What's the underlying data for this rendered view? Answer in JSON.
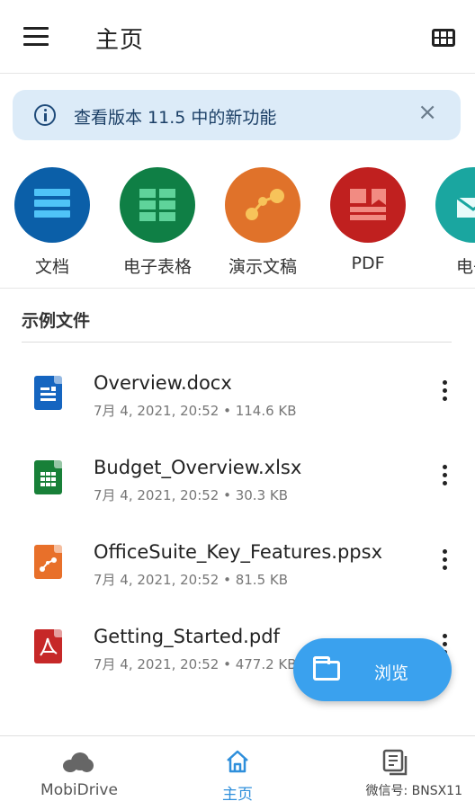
{
  "header": {
    "title": "主页"
  },
  "banner": {
    "text": "查看版本 11.5 中的新功能",
    "close": "×"
  },
  "apps": [
    {
      "label": "文档",
      "color": "#0b5fa8",
      "icon": "document-icon"
    },
    {
      "label": "电子表格",
      "color": "#0f7f45",
      "icon": "spreadsheet-icon"
    },
    {
      "label": "演示文稿",
      "color": "#e0722a",
      "icon": "presentation-icon"
    },
    {
      "label": "PDF",
      "color": "#c0201f",
      "icon": "pdf-icon"
    },
    {
      "label": "电子",
      "color": "#1aa6a0",
      "icon": "email-icon"
    }
  ],
  "section": {
    "title": "示例文件"
  },
  "files": [
    {
      "name": "Overview.docx",
      "meta": "7月 4, 2021, 20:52 • 114.6 KB",
      "color": "#1565c0",
      "icon": "docx-file-icon"
    },
    {
      "name": "Budget_Overview.xlsx",
      "meta": "7月 4, 2021, 20:52 • 30.3 KB",
      "color": "#188038",
      "icon": "xlsx-file-icon"
    },
    {
      "name": "OfficeSuite_Key_Features.ppsx",
      "meta": "7月 4, 2021, 20:52 • 81.5 KB",
      "color": "#e8702a",
      "icon": "ppsx-file-icon"
    },
    {
      "name": "Getting_Started.pdf",
      "meta": "7月 4, 2021, 20:52 • 477.2 KB",
      "color": "#c62828",
      "icon": "pdf-file-icon"
    }
  ],
  "fab": {
    "label": "浏览"
  },
  "bottom_nav": [
    {
      "label": "MobiDrive"
    },
    {
      "label": "主页"
    },
    {
      "label": ""
    }
  ],
  "watermark": "微信号: BNSX11",
  "colors": {
    "accent": "#2f8fdb",
    "fab": "#3aa1ee",
    "banner_bg": "#dcebf8"
  }
}
